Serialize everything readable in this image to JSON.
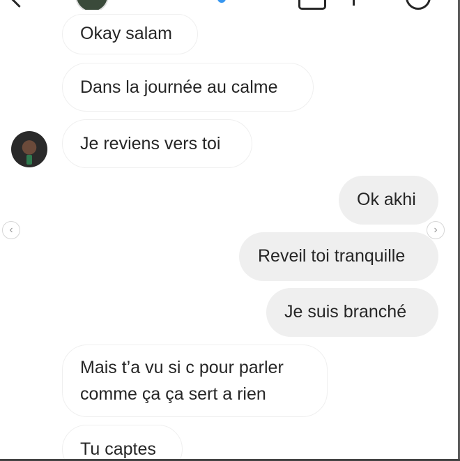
{
  "header": {
    "back_icon": "chevron-left-icon",
    "video_icon": "video-camera-icon",
    "call_icon": "phone-icon",
    "info_icon": "info-icon",
    "verified_icon": "verified-badge-icon"
  },
  "icons": {
    "prev": "‹",
    "next": "›"
  },
  "messages": [
    {
      "direction": "incoming",
      "text": "Okay salam"
    },
    {
      "direction": "incoming",
      "text": "Dans la journée au calme"
    },
    {
      "direction": "incoming",
      "text": "Je reviens vers toi"
    },
    {
      "direction": "outgoing",
      "text": "Ok akhi"
    },
    {
      "direction": "outgoing",
      "text": "Reveil toi tranquille"
    },
    {
      "direction": "outgoing",
      "text": "Je suis branché"
    },
    {
      "direction": "incoming",
      "lines": [
        "Mais t’a vu si c pour parler",
        "comme ça ça sert a rien"
      ]
    },
    {
      "direction": "incoming",
      "text": "Tu captes"
    }
  ],
  "colors": {
    "incoming_bubble": "#ffffff",
    "incoming_border": "#efefef",
    "outgoing_bubble": "#efefef",
    "text": "#262626",
    "verified": "#3897f0"
  }
}
